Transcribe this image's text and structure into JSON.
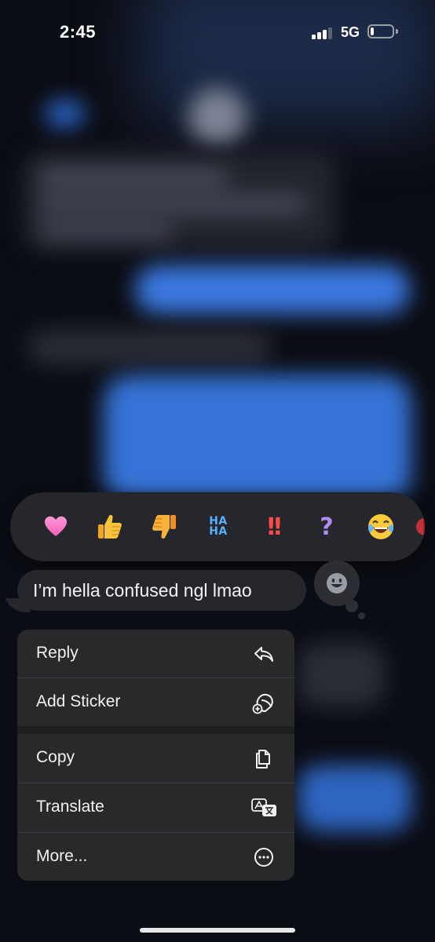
{
  "status_bar": {
    "time": "2:45",
    "network": "5G",
    "signal_bars": 3,
    "battery_level": 0.15
  },
  "tapbacks": [
    {
      "name": "heart",
      "icon": "heart-icon",
      "color": "#f77fc6"
    },
    {
      "name": "thumbs-up",
      "icon": "thumbs-up-icon",
      "glyph": "👍"
    },
    {
      "name": "thumbs-down",
      "icon": "thumbs-down-icon",
      "glyph": "👎"
    },
    {
      "name": "haha",
      "icon": "haha-icon",
      "line1": "HA",
      "line2": "HA"
    },
    {
      "name": "emphasize",
      "icon": "exclamation-icon",
      "glyph": "!!"
    },
    {
      "name": "question",
      "icon": "question-icon",
      "glyph": "?"
    },
    {
      "name": "laughing",
      "icon": "laughing-emoji-icon",
      "glyph": "😂"
    },
    {
      "name": "more-emoji",
      "icon": "partial-emoji-icon"
    }
  ],
  "message": {
    "text": "I’m hella confused ngl lmao"
  },
  "sticker_button": {
    "icon": "smiley-sticker-icon"
  },
  "menu": {
    "items": [
      {
        "label": "Reply",
        "icon": "reply-arrow-icon"
      },
      {
        "label": "Add Sticker",
        "icon": "add-sticker-icon"
      },
      {
        "label": "Copy",
        "icon": "copy-icon"
      },
      {
        "label": "Translate",
        "icon": "translate-icon"
      },
      {
        "label": "More...",
        "icon": "more-ellipsis-icon"
      }
    ]
  },
  "colors": {
    "menu_bg": "#29292c",
    "bubble_bg": "#26272c",
    "background": "#0b0d14"
  }
}
